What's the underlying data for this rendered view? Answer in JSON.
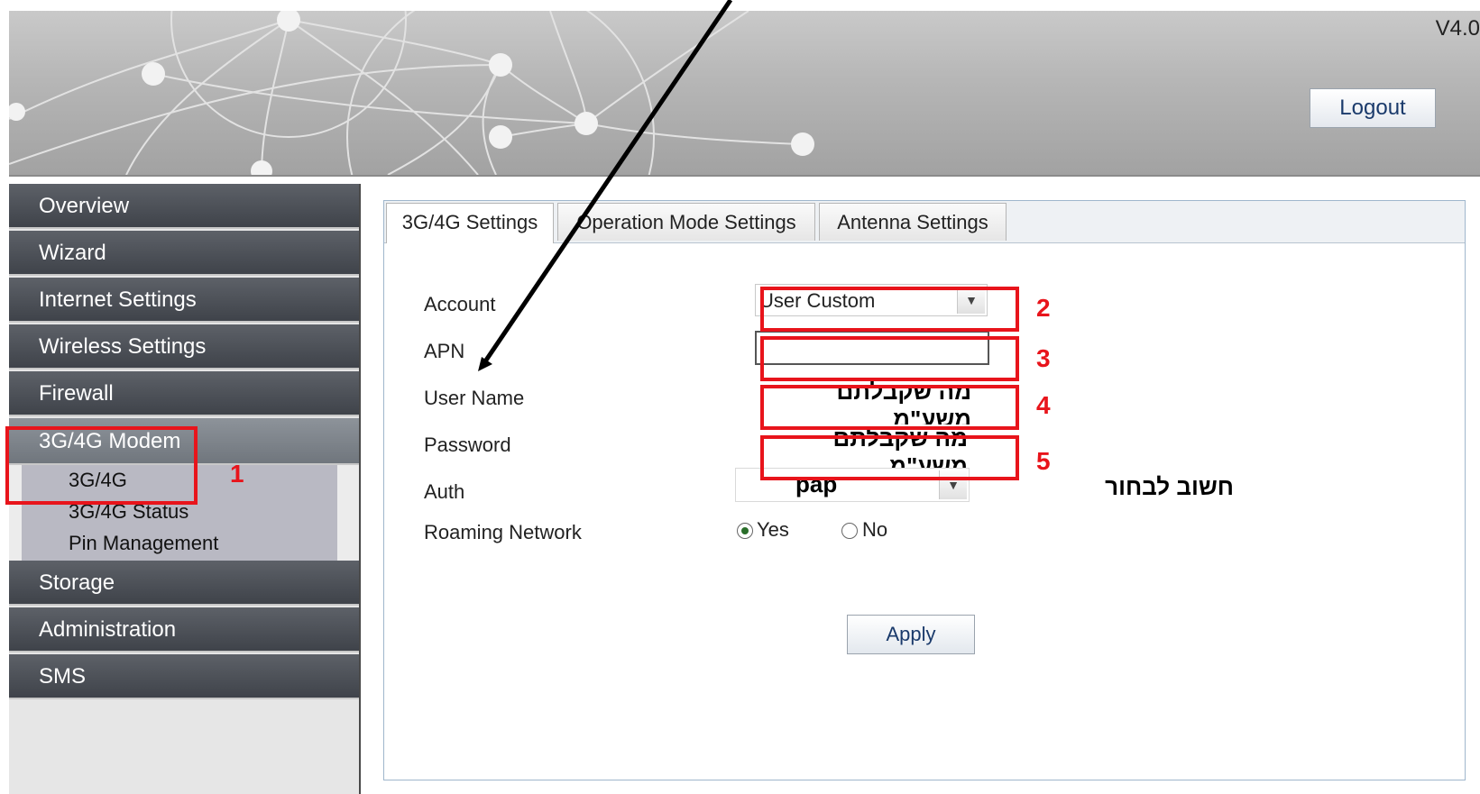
{
  "header": {
    "version": "V4.0",
    "logout_label": "Logout"
  },
  "sidebar": {
    "items": [
      {
        "label": "Overview"
      },
      {
        "label": "Wizard"
      },
      {
        "label": "Internet Settings"
      },
      {
        "label": "Wireless Settings"
      },
      {
        "label": "Firewall"
      },
      {
        "label": "3G/4G Modem"
      },
      {
        "label": "Storage"
      },
      {
        "label": "Administration"
      },
      {
        "label": "SMS"
      }
    ],
    "submenu": [
      {
        "label": "3G/4G"
      },
      {
        "label": "3G/4G Status"
      },
      {
        "label": "Pin Management"
      }
    ]
  },
  "tabs": [
    {
      "label": "3G/4G Settings"
    },
    {
      "label": "Operation Mode Settings"
    },
    {
      "label": "Antenna Settings"
    }
  ],
  "form": {
    "account": {
      "label": "Account",
      "value": "User Custom"
    },
    "apn": {
      "label": "APN",
      "value": ""
    },
    "username": {
      "label": "User Name",
      "value": "מה שקבלתם משע\"מ"
    },
    "password": {
      "label": "Password",
      "value": "מה שקבלתם משע\"מ"
    },
    "auth": {
      "label": "Auth",
      "value": "pap",
      "note": "חשוב לבחור"
    },
    "roaming": {
      "label": "Roaming Network",
      "yes_label": "Yes",
      "no_label": "No",
      "selected": "Yes"
    },
    "apply_label": "Apply"
  },
  "annotations": {
    "n1": "1",
    "n2": "2",
    "n3": "3",
    "n4": "4",
    "n5": "5",
    "color": "#e8141b"
  }
}
